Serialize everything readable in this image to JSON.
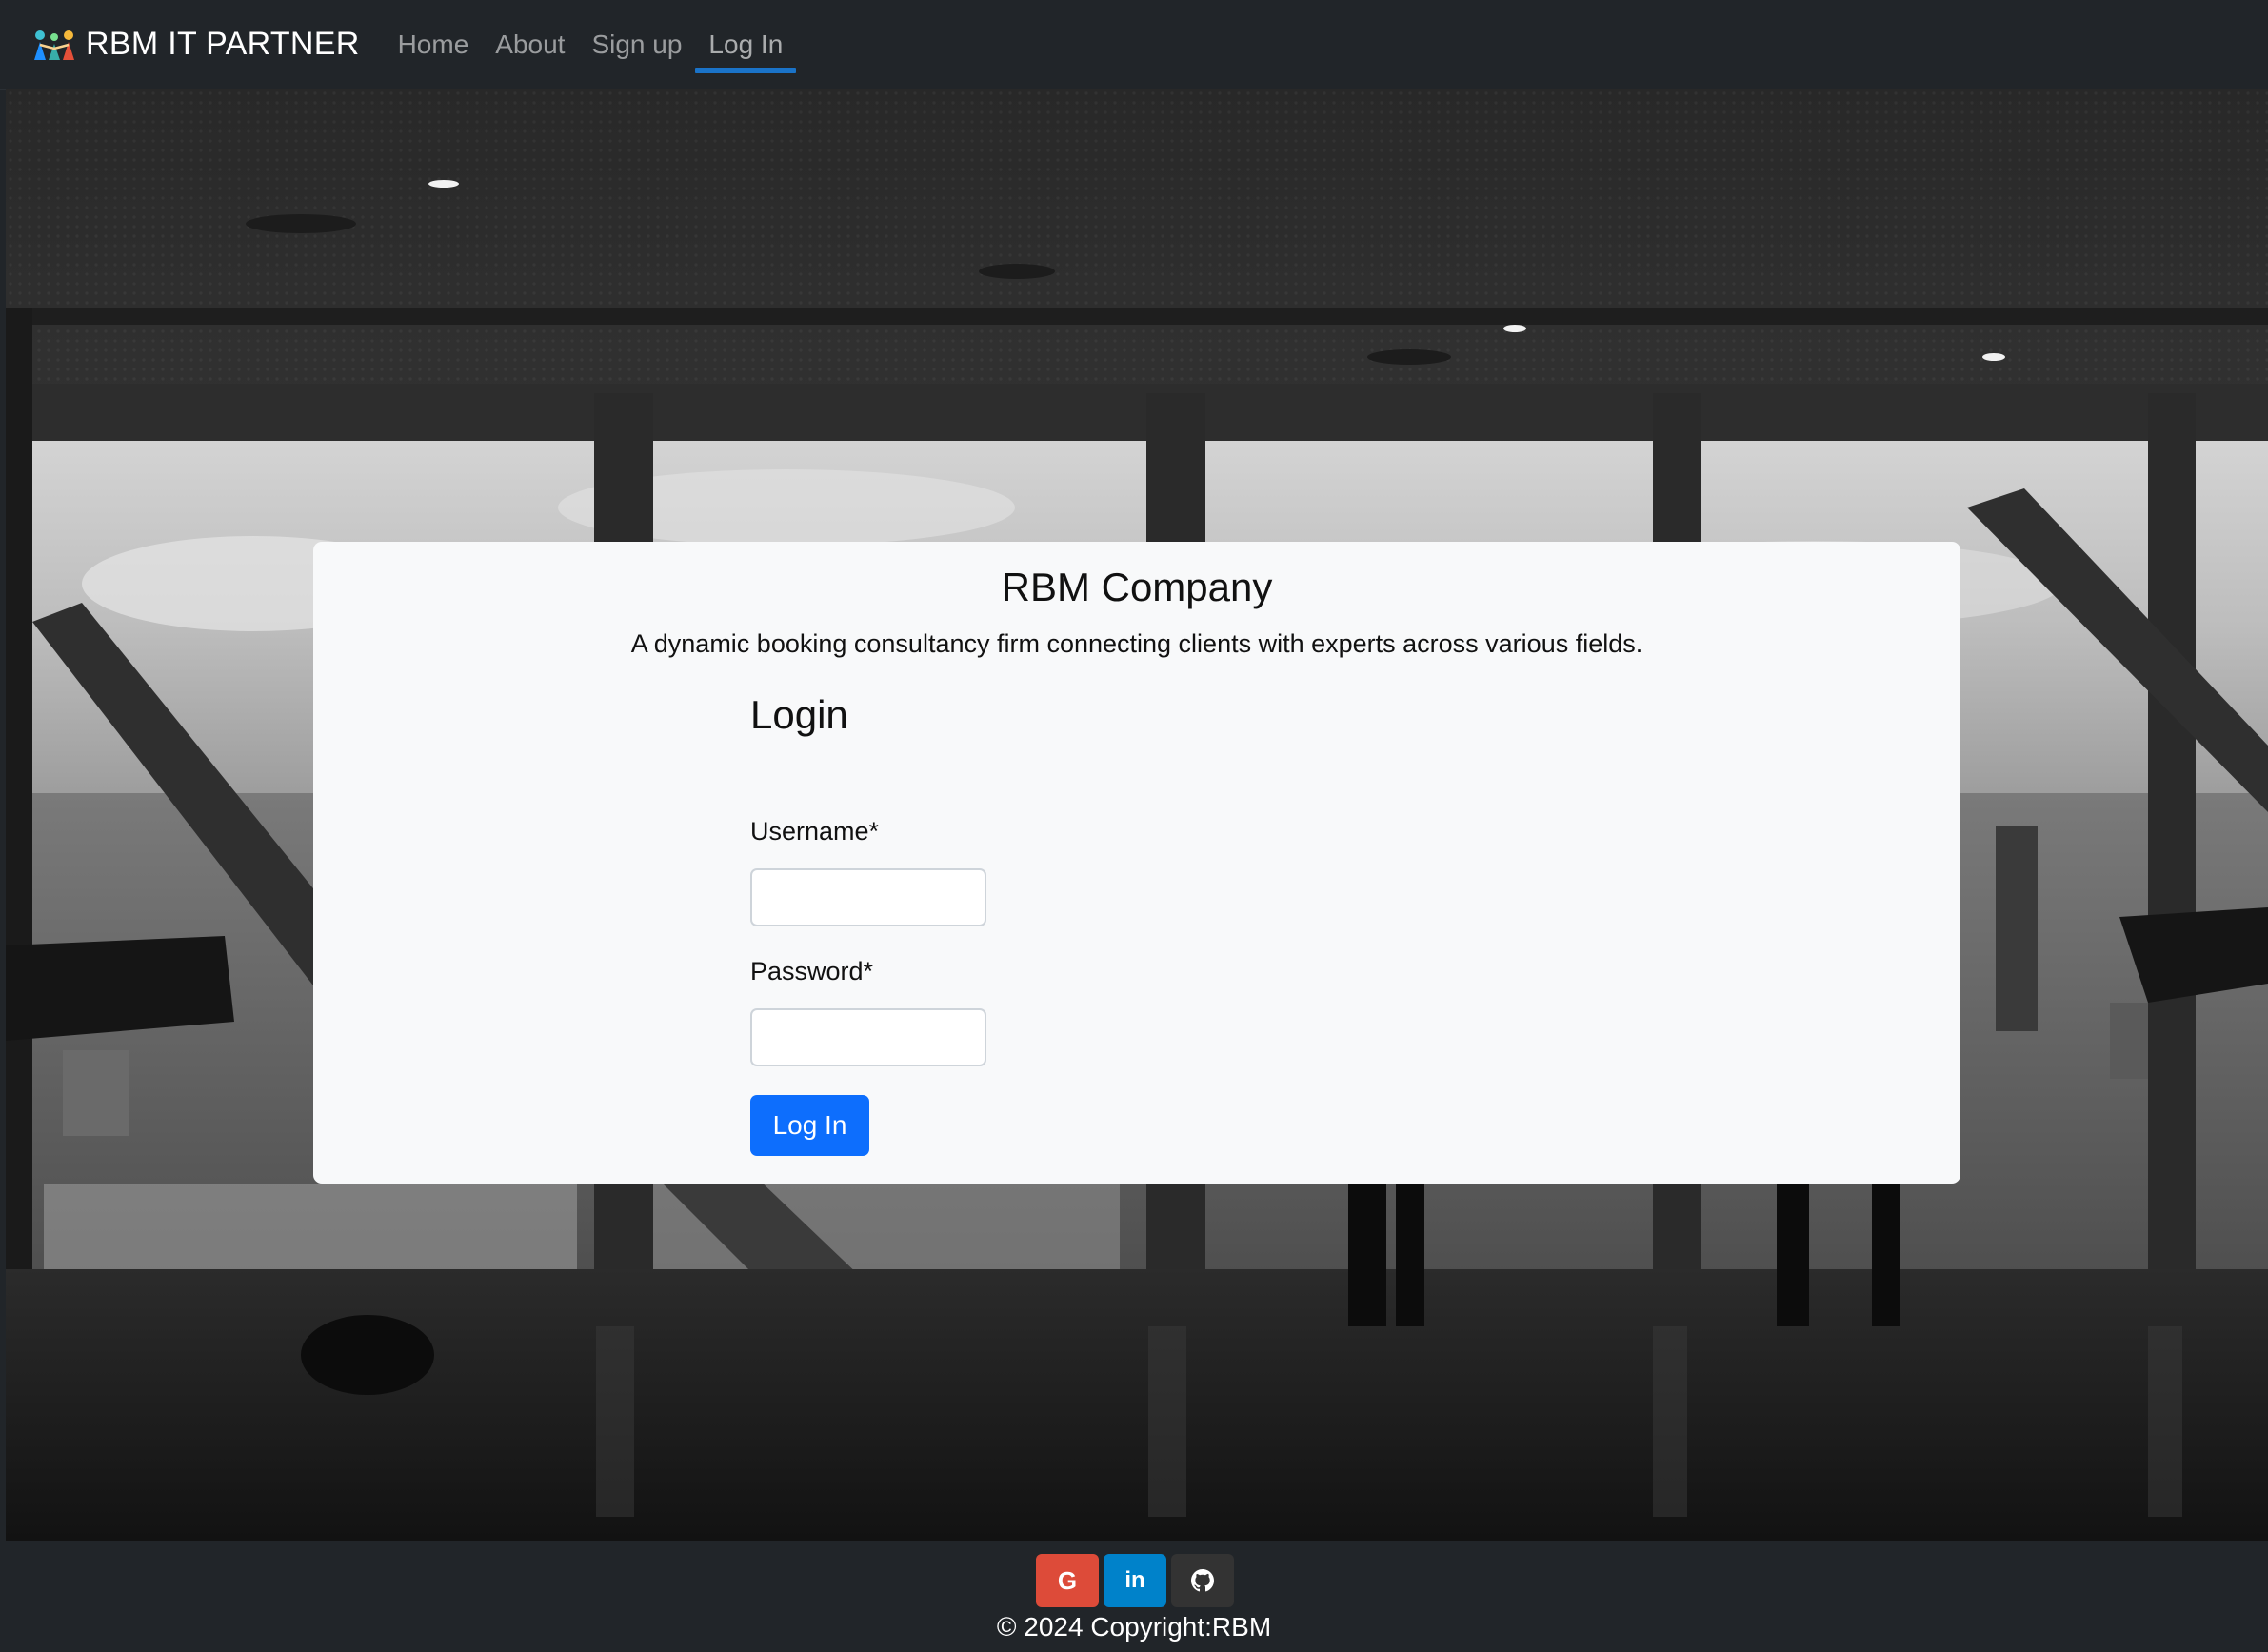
{
  "navbar": {
    "brand": "RBM IT PARTNER",
    "links": [
      {
        "label": "Home"
      },
      {
        "label": "About"
      },
      {
        "label": "Sign up"
      },
      {
        "label": "Log In"
      }
    ],
    "active": "Log In",
    "accent_color": "#1a73c8"
  },
  "card": {
    "company": "RBM Company",
    "description": "A dynamic booking consultancy firm connecting clients with experts across various fields.",
    "form": {
      "heading": "Login",
      "username_label": "Username*",
      "username_value": "",
      "password_label": "Password*",
      "password_value": "",
      "submit_label": "Log In",
      "submit_color": "#0d6efd"
    }
  },
  "footer": {
    "social": [
      {
        "icon": "google-icon",
        "glyph": "G",
        "color": "#dd4b39"
      },
      {
        "icon": "linkedin-icon",
        "glyph": "in",
        "color": "#0082ca"
      },
      {
        "icon": "github-icon",
        "glyph": "",
        "color": "#333333"
      }
    ],
    "copyright": "© 2024 Copyright:RBM"
  }
}
